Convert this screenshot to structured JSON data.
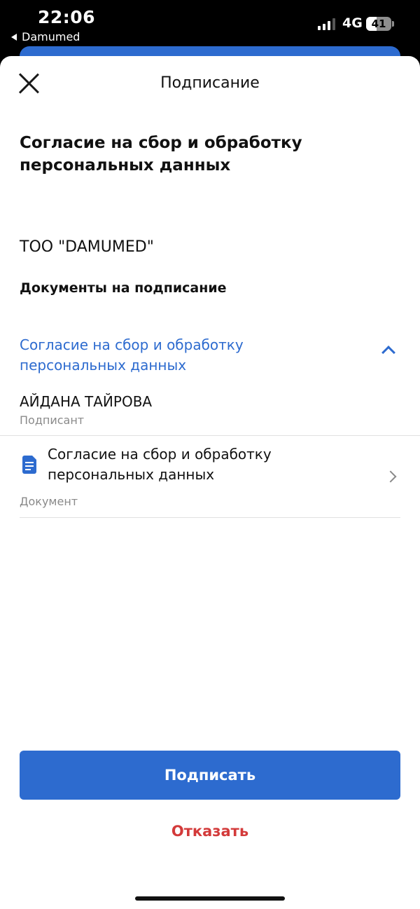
{
  "status_bar": {
    "time": "22:06",
    "back_app": "Damumed",
    "network": "4G",
    "battery": "41",
    "battery_level": 0.41
  },
  "sheet": {
    "title": "Подписание",
    "document_heading": "Согласие на сбор и обработку персональных данных",
    "organization": "ТОО \"DAMUMED\"",
    "documents_label": "Документы на подписание",
    "accordion": {
      "title": "Согласие на сбор и обработку персональных данных",
      "expanded": true
    },
    "signer": {
      "name": "АЙДАНА ТАЙРОВА",
      "role": "Подписант"
    },
    "document": {
      "name": "Согласие на сбор и обработку персональных данных",
      "type": "Документ"
    },
    "actions": {
      "sign_label": "Подписать",
      "decline_label": "Отказать"
    }
  },
  "colors": {
    "accent": "#2d6bcf",
    "danger": "#d33a3a",
    "muted_text": "#8a8a8a"
  }
}
